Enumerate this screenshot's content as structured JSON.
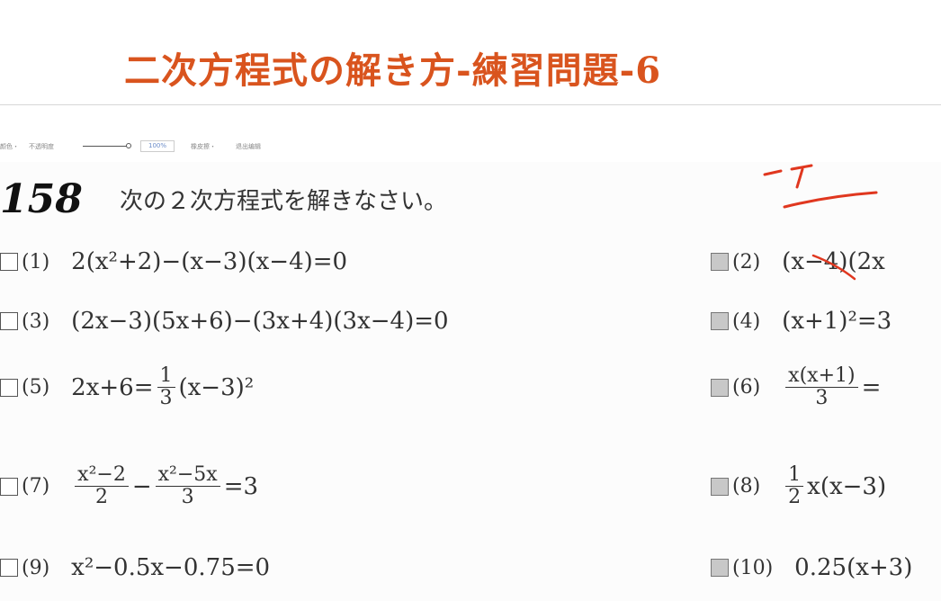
{
  "title": "二次方程式の解き方-練習問題-6",
  "toolbar": {
    "color": "颜色・",
    "opacity": "不透明度",
    "zoom": "100%",
    "thickness": "橡皮擦・",
    "exit": "退出编辑"
  },
  "heading": {
    "number": "158",
    "instruction": "次の２次方程式を解きなさい。"
  },
  "problems": [
    {
      "num": "(1)",
      "expr": "2(x²+2)−(x−3)(x−4)=0"
    },
    {
      "num": "(2)",
      "expr": "(x−4)(2x"
    },
    {
      "num": "(3)",
      "expr": "(2x−3)(5x+6)−(3x+4)(3x−4)=0"
    },
    {
      "num": "(4)",
      "expr": "(x+1)²=3"
    },
    {
      "num": "(5)",
      "expr_left": "2x+6=",
      "frac_num": "1",
      "frac_den": "3",
      "expr_right": "(x−3)²"
    },
    {
      "num": "(6)",
      "frac_num": "x(x+1)",
      "frac_den": "3",
      "expr_right": "="
    },
    {
      "num": "(7)",
      "frac1_num": "x²−2",
      "frac1_den": "2",
      "op": "−",
      "frac2_num": "x²−5x",
      "frac2_den": "3",
      "expr_right": "=3"
    },
    {
      "num": "(8)",
      "frac_num": "1",
      "frac_den": "2",
      "expr_right": "x(x−3)"
    },
    {
      "num": "(9)",
      "expr": "x²−0.5x−0.75=0"
    },
    {
      "num": "(10)",
      "expr": "0.25(x+3)"
    }
  ],
  "accent_color": "#d9541e",
  "pen_color": "#e0371f"
}
